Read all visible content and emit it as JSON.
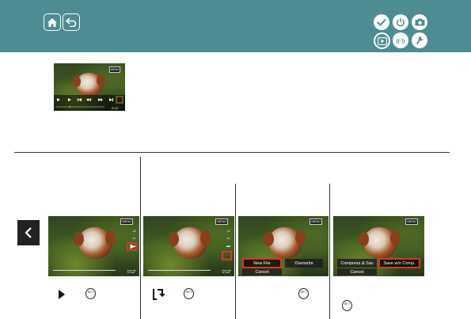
{
  "header": {
    "nav_icons": [
      "home-icon",
      "back-icon"
    ],
    "mode_icons": [
      "checkmark-icon",
      "power-icon",
      "camera-icon",
      "playback-icon",
      "wireless-icon",
      "wrench-icon"
    ],
    "active_mode": "playback-icon",
    "color": "#4d8c93"
  },
  "preview": {
    "menu_label": "MENU",
    "time": "0'12\""
  },
  "steps": [
    {
      "menu_label": "MENU",
      "time": "0'12\"",
      "icons": [
        "play-icon",
        "set-button-icon"
      ]
    },
    {
      "menu_label": "MENU",
      "time": "0'12\"",
      "icons": [
        "edit-icon",
        "set-button-icon"
      ]
    },
    {
      "menu_label": "MENU",
      "options": [
        "New File",
        "Overwrite"
      ],
      "cancel": "Cancel",
      "selected": "New File",
      "icons": [
        "set-button-icon"
      ]
    },
    {
      "menu_label": "MENU",
      "options": [
        "Compress & Sav",
        "Save w/o Comp."
      ],
      "cancel": "Cancel",
      "selected": "Save w/o Comp.",
      "icons": [
        "set-button-icon"
      ]
    }
  ],
  "set_label": "SET",
  "nav": {
    "prev_icon": "chevron-left-icon"
  },
  "accent": "#e1322d"
}
